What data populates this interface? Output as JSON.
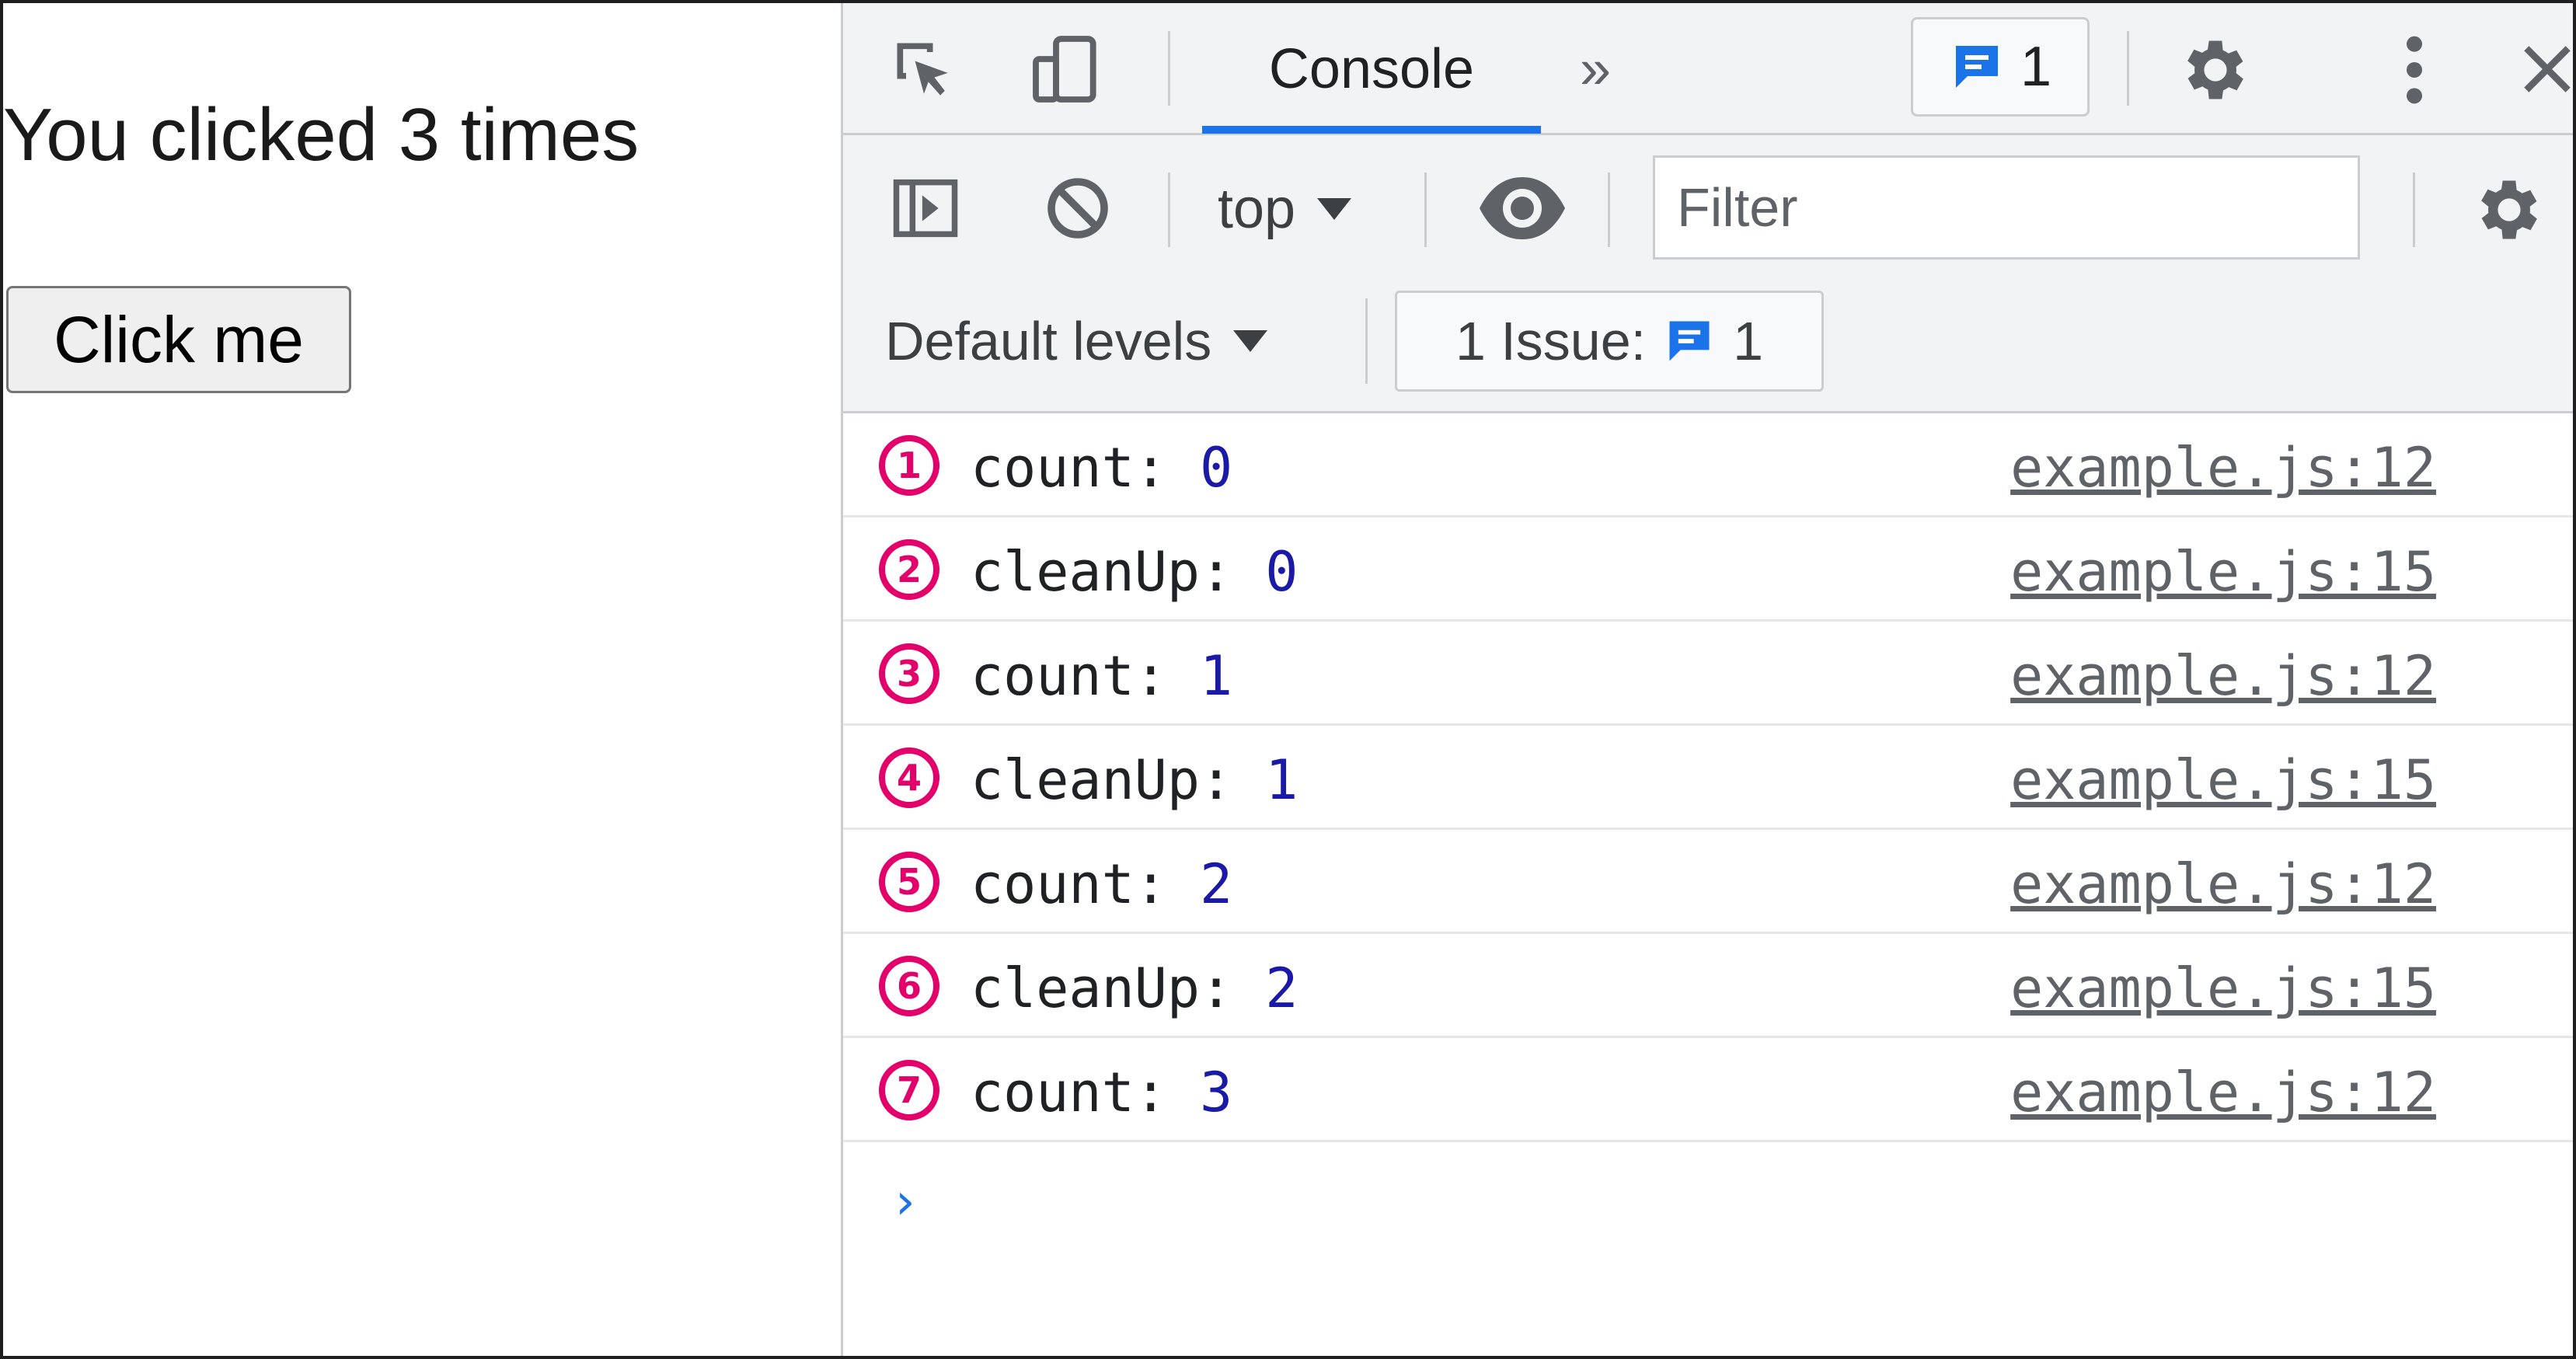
{
  "page": {
    "counter_text": "You clicked 3 times",
    "button_label": "Click me"
  },
  "devtools": {
    "tabs": {
      "console_label": "Console",
      "more_tabs_glyph": "»"
    },
    "issues_counter": "1",
    "toolbar": {
      "context_label": "top",
      "filter_placeholder": "Filter",
      "levels_label": "Default levels",
      "issue_label": "1 Issue:",
      "issue_count": "1"
    },
    "icons": [
      "inspect-element-icon",
      "device-toolbar-icon",
      "issues-message-icon",
      "settings-gear-icon",
      "more-vertical-icon",
      "close-icon",
      "sidebar-toggle-icon",
      "clear-console-icon",
      "live-expression-eye-icon",
      "console-settings-gear-icon"
    ],
    "colors": {
      "accent_blue": "#1a73e8",
      "badge_magenta": "#e3006b",
      "value_blue": "#1a1aa6"
    }
  },
  "console_rows": [
    {
      "badge": "1",
      "label": "count: ",
      "value": "0",
      "source": "example.js:12"
    },
    {
      "badge": "2",
      "label": "cleanUp: ",
      "value": "0",
      "source": "example.js:15"
    },
    {
      "badge": "3",
      "label": "count: ",
      "value": "1",
      "source": "example.js:12"
    },
    {
      "badge": "4",
      "label": "cleanUp: ",
      "value": "1",
      "source": "example.js:15"
    },
    {
      "badge": "5",
      "label": "count: ",
      "value": "2",
      "source": "example.js:12"
    },
    {
      "badge": "6",
      "label": "cleanUp: ",
      "value": "2",
      "source": "example.js:15"
    },
    {
      "badge": "7",
      "label": "count: ",
      "value": "3",
      "source": "example.js:12"
    }
  ],
  "prompt_glyph": "›"
}
